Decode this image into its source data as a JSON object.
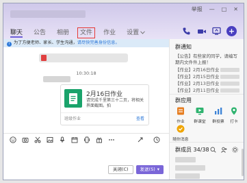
{
  "window": {
    "controls": [
      "举报",
      "—",
      "□",
      "✕"
    ]
  },
  "tabs": [
    {
      "label": "聊天",
      "active": true
    },
    {
      "label": "公告",
      "active": false
    },
    {
      "label": "相册",
      "active": false
    },
    {
      "label": "文件",
      "active": false,
      "highlighted": true
    },
    {
      "label": "作业",
      "active": false
    },
    {
      "label": "设置",
      "active": false
    }
  ],
  "tab_more_icon": "chevron-down-icon",
  "header_icons": [
    "phone-icon",
    "video-icon",
    "screen-share-icon",
    "add-icon"
  ],
  "banner": {
    "text": "为了方便老师、家长、学生沟通，",
    "link": "请尽快完善身份信息。"
  },
  "timestamp": "10:30:18",
  "homework_card": {
    "title": "2月16日作业",
    "description": "请完成千里第三十二页，将相关界面截图。拍",
    "source": "班级作业",
    "action": "查看"
  },
  "toolbar_icons": [
    "emoji-icon",
    "screenshot-icon",
    "scissors-icon",
    "image-icon",
    "voice-icon",
    "calendar-icon",
    "shake-icon",
    "gift-icon",
    "more-icon"
  ],
  "toolbar_right_icons": [
    "resize-icon",
    "history-icon"
  ],
  "buttons": {
    "close": "关闭(C)",
    "send": "发送(S)",
    "send_dropdown": "▾"
  },
  "sidebar": {
    "notice_title": "群通知",
    "notice_lines": [
      "【公告】有些家的同学，请编写",
      "期内文件件上报！",
      "【作业】2月16日作业",
      "【作业】2月15日作业",
      "【作业】2月13日作业",
      "【作业】2月11日作业"
    ],
    "apps_title": "群应用",
    "apps": [
      {
        "label": "作业",
        "icon": "homework-icon",
        "color": "#e67e22"
      },
      {
        "label": "群课堂",
        "icon": "classroom-icon",
        "color": "#2fb36f"
      },
      {
        "label": "群投票",
        "icon": "vote-icon",
        "color": "#3b82d6"
      },
      {
        "label": "打卡",
        "icon": "checkin-icon",
        "color": "#2fb36f"
      },
      {
        "label": "随你消息",
        "icon": "message-icon",
        "color": "#f0a500"
      }
    ],
    "members_title": "群成员 34/38",
    "members_icons": [
      "search-member-icon",
      "add-member-icon",
      "settings-icon"
    ]
  },
  "colors": {
    "accent": "#6d5fd8",
    "send_button": "#7a66d8",
    "card_icon": "#1aa36b",
    "highlight_box": "#e53935",
    "link": "#2f7ad9"
  }
}
